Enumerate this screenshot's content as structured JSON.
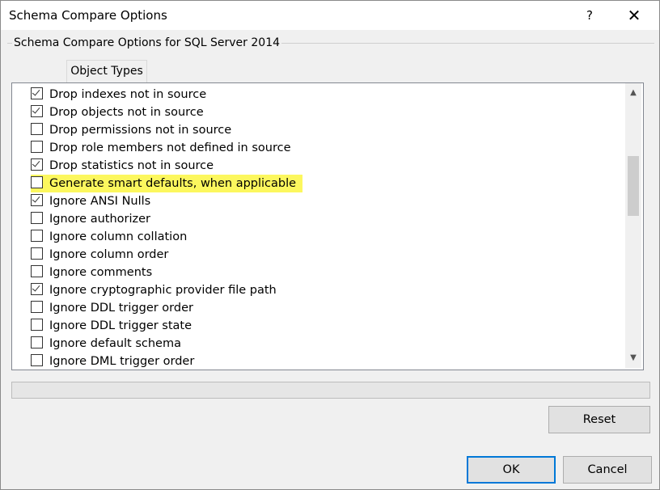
{
  "window": {
    "title": "Schema Compare Options",
    "help_label": "?",
    "close_label": "✕"
  },
  "group": {
    "title": "Schema Compare Options for SQL Server 2014"
  },
  "tabs": [
    {
      "label": "Object Types"
    }
  ],
  "options": [
    {
      "label": "Drop indexes not in source",
      "checked": true,
      "highlighted": false
    },
    {
      "label": "Drop objects not in source",
      "checked": true,
      "highlighted": false
    },
    {
      "label": "Drop permissions not in source",
      "checked": false,
      "highlighted": false
    },
    {
      "label": "Drop role members not defined in source",
      "checked": false,
      "highlighted": false
    },
    {
      "label": "Drop statistics not in source",
      "checked": true,
      "highlighted": false
    },
    {
      "label": "Generate smart defaults, when applicable",
      "checked": false,
      "highlighted": true
    },
    {
      "label": "Ignore ANSI Nulls",
      "checked": true,
      "highlighted": false
    },
    {
      "label": "Ignore authorizer",
      "checked": false,
      "highlighted": false
    },
    {
      "label": "Ignore column collation",
      "checked": false,
      "highlighted": false
    },
    {
      "label": "Ignore column order",
      "checked": false,
      "highlighted": false
    },
    {
      "label": "Ignore comments",
      "checked": false,
      "highlighted": false
    },
    {
      "label": "Ignore cryptographic provider file path",
      "checked": true,
      "highlighted": false
    },
    {
      "label": "Ignore DDL trigger order",
      "checked": false,
      "highlighted": false
    },
    {
      "label": "Ignore DDL trigger state",
      "checked": false,
      "highlighted": false
    },
    {
      "label": "Ignore default schema",
      "checked": false,
      "highlighted": false
    },
    {
      "label": "Ignore DML trigger order",
      "checked": false,
      "highlighted": false
    }
  ],
  "scrollbar": {
    "up_icon": "chevron-up-icon",
    "down_icon": "chevron-down-icon",
    "position_fraction": 0.3
  },
  "progress": {
    "value_fraction": 0
  },
  "buttons": {
    "reset_label": "Reset",
    "ok_label": "OK",
    "cancel_label": "Cancel"
  },
  "colors": {
    "highlight": "#fcf75e",
    "default_button_border": "#0078d7"
  }
}
